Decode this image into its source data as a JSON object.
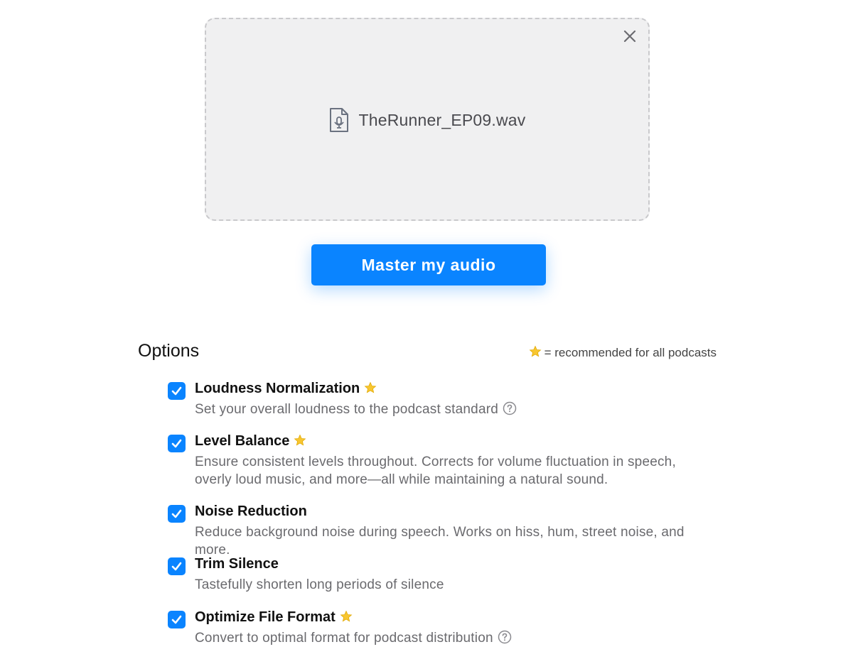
{
  "upload": {
    "file_name": "TheRunner_EP09.wav",
    "file_icon": "audio-file-icon",
    "close_icon": "close-icon"
  },
  "actions": {
    "master_label": "Master my audio"
  },
  "options": {
    "title": "Options",
    "legend_star": "⭐",
    "legend_text": "= recommended for all podcasts",
    "items": [
      {
        "title": "Loudness Normalization",
        "recommended": true,
        "checked": true,
        "description": "Set your overall loudness to the podcast standard",
        "has_help": true
      },
      {
        "title": "Level Balance",
        "recommended": true,
        "checked": true,
        "description": "Ensure consistent levels throughout. Corrects for volume fluctuation in speech, overly loud music, and more—all while maintaining a natural sound.",
        "has_help": false
      },
      {
        "title": "Noise Reduction",
        "recommended": false,
        "checked": true,
        "description": "Reduce background noise during speech. Works on hiss, hum, street noise, and more.",
        "has_help": false
      },
      {
        "title": "Trim Silence",
        "recommended": false,
        "checked": true,
        "description": "Tastefully shorten long periods of silence",
        "has_help": false
      },
      {
        "title": "Optimize File Format",
        "recommended": true,
        "checked": true,
        "description": "Convert to optimal format for podcast distribution",
        "has_help": true
      }
    ]
  },
  "colors": {
    "accent": "#0a84ff",
    "star": "#f5c518",
    "dropzone_bg": "#f0f0f1"
  }
}
